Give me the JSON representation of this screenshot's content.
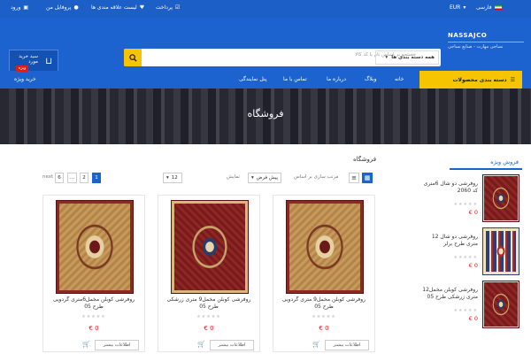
{
  "topbar": {
    "language": "فارسی",
    "currency": "EUR",
    "account": "پروفایل من",
    "wishlist": "لیست علاقه مندی ها",
    "checkout": "پرداخت",
    "login": "ورود"
  },
  "header": {
    "brand": "NASSAJCO",
    "tagline": "نساجی مهارت - صنایع نساجی",
    "search_placeholder": "جستجو بر اساس نام یا کد کالا",
    "search_category": "همه دسته بندی ها",
    "cart_label": "سبد خرید مورد",
    "cart_count": "0"
  },
  "nav": {
    "categories": "دسته بندی محصولات",
    "links": [
      "خانه",
      "وبلاگ",
      "درباره ما",
      "تماس با ما",
      "پنل نمایندگی"
    ],
    "special_badge": "ویژه",
    "special": "خرید ویژه"
  },
  "banner": {
    "title": "فروشگاه"
  },
  "sidebar": {
    "heading": "فروش ویژه",
    "items": [
      {
        "name": "روفرشی دو شال 6متری کد 2060",
        "price": "€ 0"
      },
      {
        "name": "روفرشی دو شال 12 متری طرح برلر",
        "price": "€ 0"
      },
      {
        "name": "روفرشی کوبلن مخمل12 متری زرشکی طرح 05",
        "price": "€ 0"
      }
    ]
  },
  "shop": {
    "title": "فروشگاه",
    "sort_label": "مرتب سازی بر اساس",
    "sort_value": "پیش فرض",
    "show_label": "نمایش",
    "show_value": "12",
    "pages": [
      "1",
      "2",
      "...",
      "6"
    ],
    "next": "next"
  },
  "products": [
    {
      "name": "روفرشی کوبلن مخمل9 متری گردویی طرح 05",
      "price": "€ 0",
      "more": "اطلاعات بیشتر"
    },
    {
      "name": "روفرشی کوبلن مخمل9 متری زرشکی طرح 05",
      "price": "€ 0",
      "more": "اطلاعات بیشتر"
    },
    {
      "name": "روفرشی کوبلن مخمل6متری گردویی طرح 05",
      "price": "€ 0",
      "more": "اطلاعات بیشتر"
    }
  ]
}
